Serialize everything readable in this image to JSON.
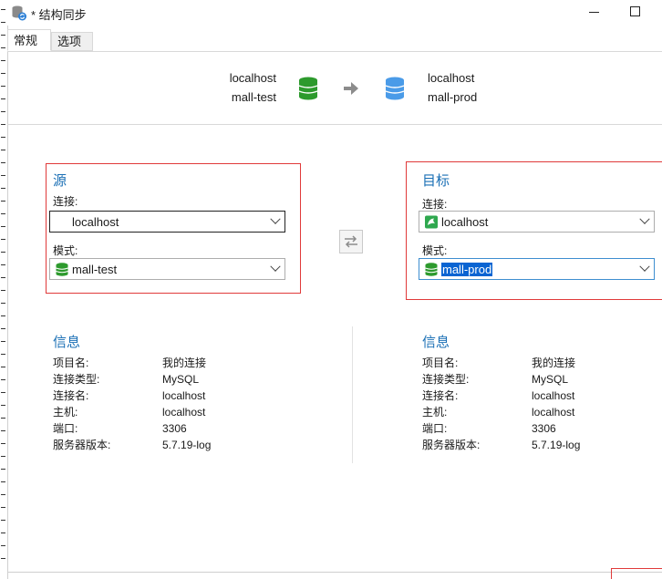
{
  "window": {
    "title": "* 结构同步"
  },
  "tabs": [
    {
      "label": "常规"
    },
    {
      "label": "选项"
    }
  ],
  "header": {
    "source": {
      "host": "localhost",
      "db": "mall-test",
      "color": "#2d9a2d"
    },
    "target": {
      "host": "localhost",
      "db": "mall-prod",
      "color": "#4a9be8"
    }
  },
  "source": {
    "title": "源",
    "connection_label": "连接:",
    "connection_value": "localhost",
    "schema_label": "模式:",
    "schema_value": "mall-test"
  },
  "target": {
    "title": "目标",
    "connection_label": "连接:",
    "connection_value": "localhost",
    "schema_label": "模式:",
    "schema_value": "mall-prod"
  },
  "source_info": {
    "title": "信息",
    "rows": [
      {
        "key": "项目名:",
        "value": "我的连接"
      },
      {
        "key": "连接类型:",
        "value": "MySQL"
      },
      {
        "key": "连接名:",
        "value": "localhost"
      },
      {
        "key": "主机:",
        "value": "localhost"
      },
      {
        "key": "端口:",
        "value": "3306"
      },
      {
        "key": "服务器版本:",
        "value": "5.7.19-log"
      }
    ]
  },
  "target_info": {
    "title": "信息",
    "rows": [
      {
        "key": "项目名:",
        "value": "我的连接"
      },
      {
        "key": "连接类型:",
        "value": "MySQL"
      },
      {
        "key": "连接名:",
        "value": "localhost"
      },
      {
        "key": "主机:",
        "value": "localhost"
      },
      {
        "key": "端口:",
        "value": "3306"
      },
      {
        "key": "服务器版本:",
        "value": "5.7.19-log"
      }
    ]
  },
  "colors": {
    "accent": "#1a6fb5",
    "highlight_border": "#e03a3a",
    "selection": "#0a64d2"
  }
}
